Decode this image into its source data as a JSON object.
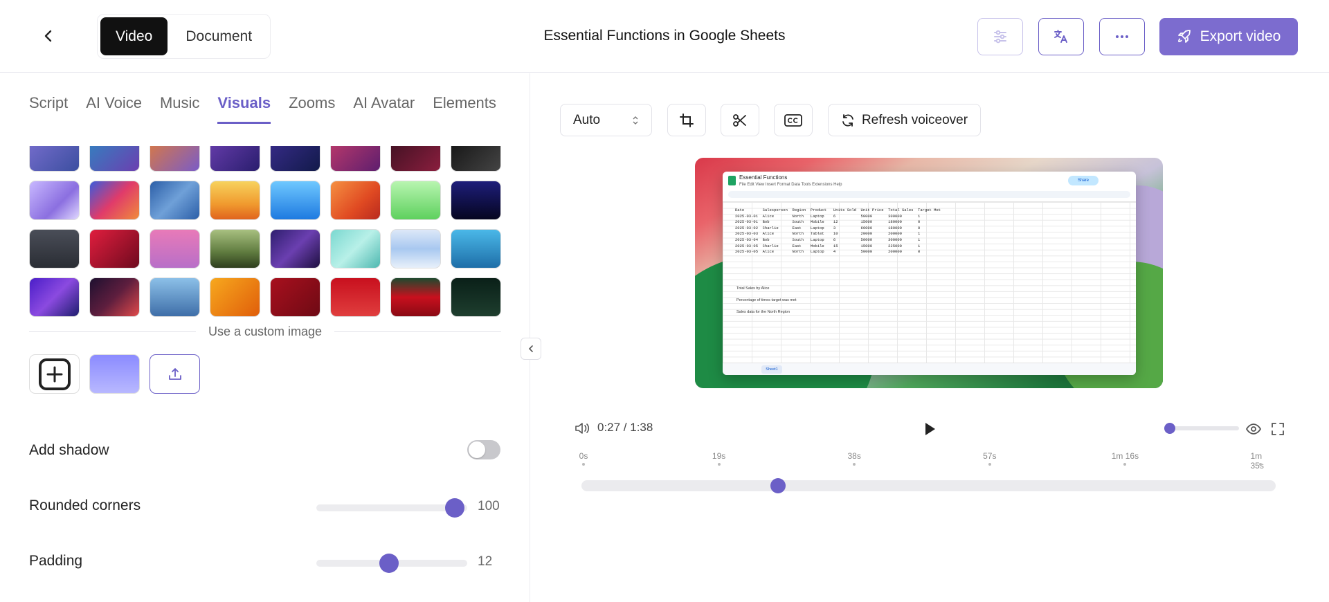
{
  "header": {
    "mode_video": "Video",
    "mode_document": "Document",
    "title": "Essential Functions in Google Sheets",
    "export_label": "Export video"
  },
  "tabs": [
    {
      "label": "Script"
    },
    {
      "label": "AI Voice"
    },
    {
      "label": "Music"
    },
    {
      "label": "Visuals",
      "active": true
    },
    {
      "label": "Zooms"
    },
    {
      "label": "AI Avatar"
    },
    {
      "label": "Elements"
    }
  ],
  "backgrounds": [
    "linear-gradient(135deg,#7a6fd0,#3c4fa0)",
    "linear-gradient(135deg,#2e86c1,#6c3fb0)",
    "linear-gradient(135deg,#e07b39,#7a5cc7)",
    "linear-gradient(135deg,#6b3fb0,#2a1e6e)",
    "linear-gradient(135deg,#3a2d8e,#121a4a)",
    "linear-gradient(135deg,#c23c6a,#5e1e6e)",
    "linear-gradient(135deg,#3a1020,#8a1e3e)",
    "linear-gradient(135deg,#111,#444)",
    "linear-gradient(135deg,#c8b8ff,#8b6fe0 60%,#e0d8ff)",
    "linear-gradient(135deg,#3b5bdb,#e03b6a 50%,#f08c3b)",
    "linear-gradient(135deg,#2b5ea7,#6fa0d8 50%,#2b5ea7)",
    "linear-gradient(180deg,#f7d25e,#f09a2e 60%,#e0641e)",
    "linear-gradient(180deg,#6fc8ff,#1e7ae0)",
    "linear-gradient(135deg,#f59042,#e04a22 60%,#b8291e)",
    "linear-gradient(180deg,#b8f5b0,#5ed05e)",
    "linear-gradient(180deg,#1e1e7a,#050520)",
    "linear-gradient(180deg,#4a4e58,#2a2d34)",
    "linear-gradient(135deg,#e01e3e,#6e0a1e)",
    "linear-gradient(180deg,#e87ab8,#b86fc8)",
    "linear-gradient(180deg,#a8c080,#5e7a3e 60%,#2e3e1e)",
    "linear-gradient(135deg,#2e1e6e,#6b3fb0 50%,#1e1040)",
    "linear-gradient(135deg,#7ad8d0,#b8f0e8 50%,#4eb8b0)",
    "linear-gradient(180deg,#dde8f8,#a8c8f0 50%,#e8f0fa)",
    "linear-gradient(180deg,#4ab8e8,#1e6ea8)",
    "linear-gradient(135deg,#4a1ec8,#8b4ae0 50%,#1e1e6e)",
    "linear-gradient(135deg,#1e1030,#5e1e3e 50%,#e04a4a)",
    "linear-gradient(180deg,#8cc0e8,#3e6ea8)",
    "linear-gradient(135deg,#f7a81e,#e05e0a)",
    "linear-gradient(135deg,#a8101e,#6e0a14)",
    "linear-gradient(180deg,#c8101e,#e03e3e)",
    "linear-gradient(180deg,#1e4a2e,#c8101e 50%,#8a0a14)",
    "linear-gradient(180deg,#0a2018,#1e3e2e)"
  ],
  "custom_image_label": "Use a custom image",
  "custom_preview_color": "linear-gradient(180deg,#8b8bff,#b8b8ff)",
  "settings": {
    "shadow_label": "Add shadow",
    "shadow_on": false,
    "rounded_label": "Rounded corners",
    "rounded_value": "100",
    "rounded_fraction": 1.0,
    "padding_label": "Padding",
    "padding_value": "12",
    "padding_fraction": 0.48
  },
  "toolbar": {
    "aspect_value": "Auto",
    "refresh_label": "Refresh voiceover"
  },
  "preview_sheet": {
    "title": "Essential Functions",
    "menu": "File  Edit  View  Insert  Format  Data  Tools  Extensions  Help",
    "share": "Share",
    "rows": [
      "Date        Salesperson  Region  Product   Units Sold  Unit Price  Total Sales  Target Met",
      "2025-03-01  Alice        North   Laptop    6           50000       300000       1",
      "2025-03-01  Bob          South   Mobile    12          15000       180000       0",
      "2025-03-02  Charlie      East    Laptop    3           60000       180000       0",
      "2025-03-03  Alice        North   Tablet    10          20000       200000       1",
      "2025-03-04  Bob          South   Laptop    6           50000       300000       1",
      "2025-03-05  Charlie      East    Mobile    15          15000       225000       1",
      "2025-03-05  Alice        North   Laptop    4           50000       200000       0"
    ],
    "note1": "Total Sales by Alice",
    "note2": "Percentage of times target was met",
    "note3": "Sales data for the North Region",
    "sheet_tab": "Sheet1"
  },
  "player": {
    "time": "0:27 / 1:38",
    "progress_fraction": 0.283,
    "volume_fraction": 0.0,
    "ticks": [
      "0s",
      "19s",
      "38s",
      "57s",
      "1m 16s",
      "1m 35s"
    ]
  }
}
